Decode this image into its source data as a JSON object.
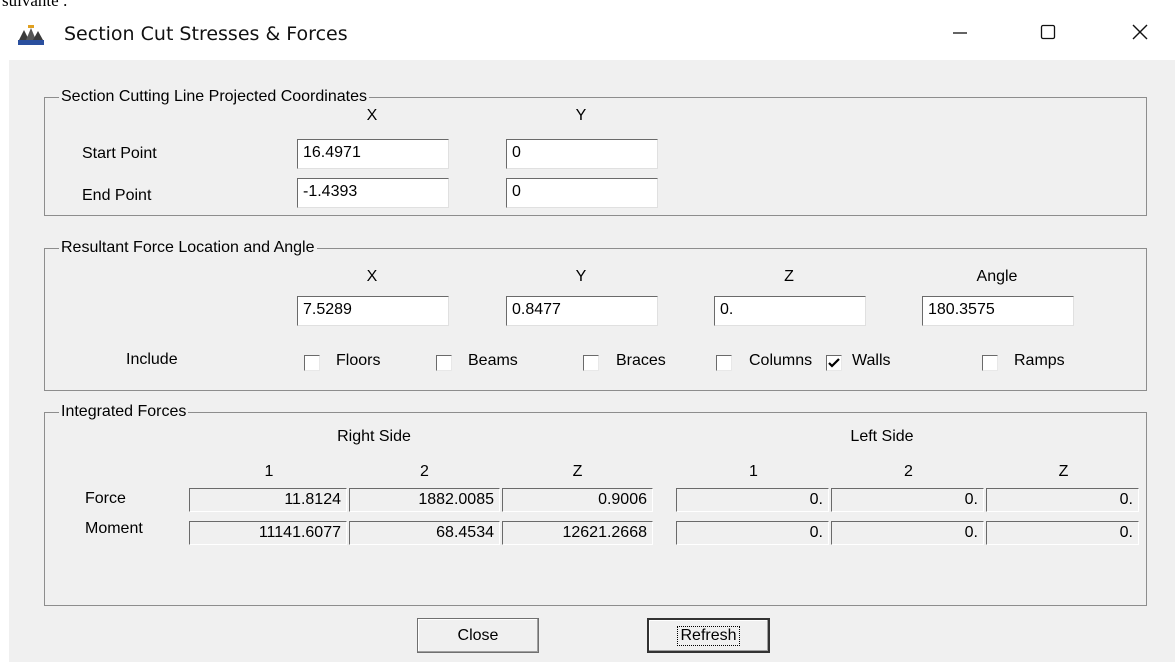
{
  "doc_fragment": "suivante :",
  "window": {
    "title": "Section Cut Stresses & Forces",
    "icon": "etabs-app-icon",
    "controls": {
      "minimize": "minimize-icon",
      "maximize": "maximize-icon",
      "close": "close-icon"
    }
  },
  "section_line": {
    "legend": "Section Cutting Line Projected Coordinates",
    "col_x": "X",
    "col_y": "Y",
    "rows": [
      {
        "label": "Start Point",
        "x": "16.4971",
        "y": "0"
      },
      {
        "label": "End Point",
        "x": "-1.4393",
        "y": "0"
      }
    ]
  },
  "resultant": {
    "legend": "Resultant Force Location and Angle",
    "headers": [
      "X",
      "Y",
      "Z",
      "Angle"
    ],
    "values": [
      "7.5289",
      "0.8477",
      "0.",
      "180.3575"
    ],
    "include_label": "Include",
    "include": [
      {
        "label": "Floors",
        "checked": false
      },
      {
        "label": "Beams",
        "checked": false
      },
      {
        "label": "Braces",
        "checked": false
      },
      {
        "label": "Columns",
        "checked": false
      },
      {
        "label": "Walls",
        "checked": true
      },
      {
        "label": "Ramps",
        "checked": false
      }
    ]
  },
  "integrated": {
    "legend": "Integrated Forces",
    "right_side": "Right Side",
    "left_side": "Left Side",
    "col_headers": [
      "1",
      "2",
      "Z",
      "1",
      "2",
      "Z"
    ],
    "rows": [
      {
        "label": "Force",
        "values": [
          "11.8124",
          "1882.0085",
          "0.9006",
          "0.",
          "0.",
          "0."
        ]
      },
      {
        "label": "Moment",
        "values": [
          "11141.6077",
          "68.4534",
          "12621.2668",
          "0.",
          "0.",
          "0."
        ]
      }
    ]
  },
  "buttons": {
    "close": "Close",
    "refresh": "Refresh"
  }
}
